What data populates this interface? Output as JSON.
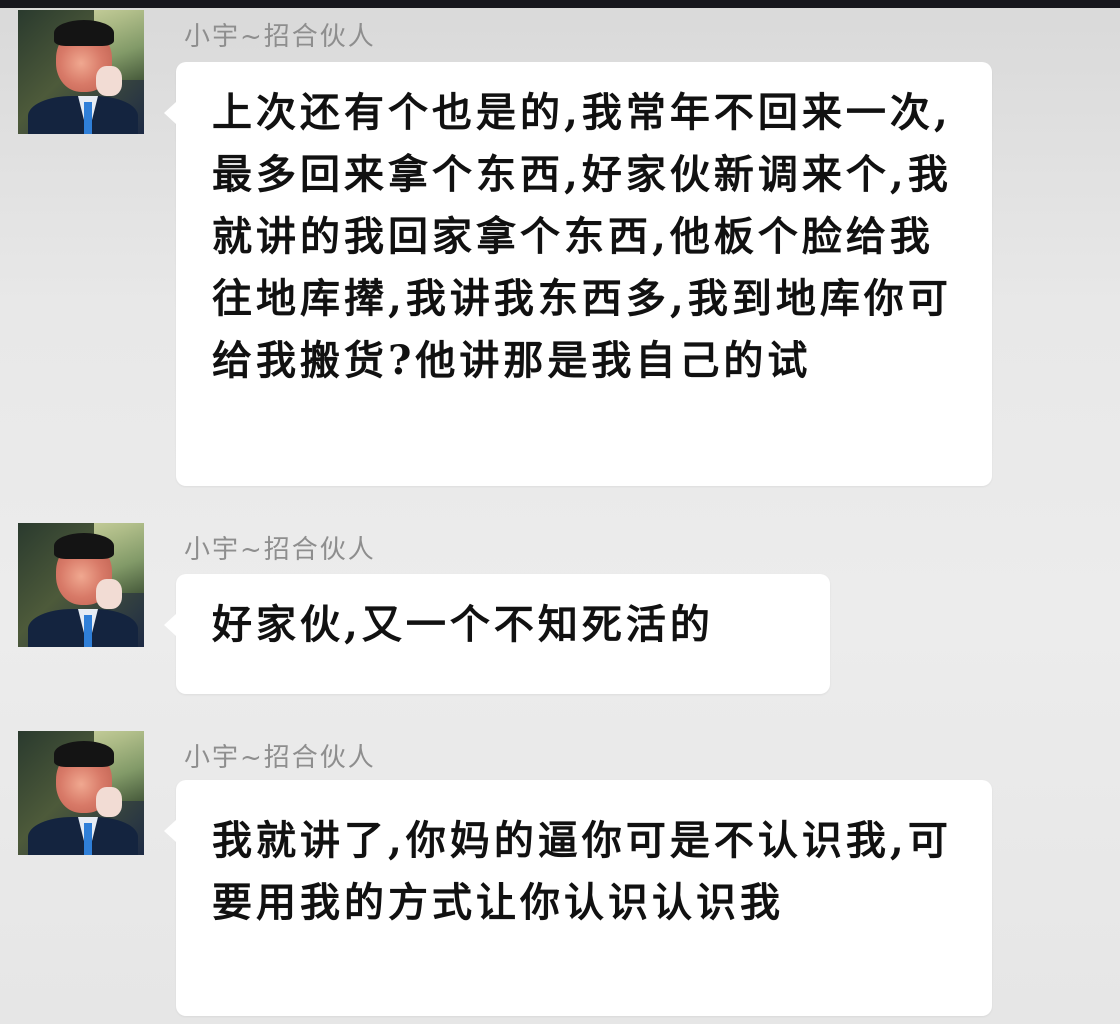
{
  "chat": {
    "messages": [
      {
        "sender": "小宇~招合伙人",
        "avatar": "avatar-man-in-suit",
        "text": "上次还有个也是的,我常年不回来一次,最多回来拿个东西,好家伙新调来个,我就讲的我回家拿个东西,他板个脸给我往地库撵,我讲我东西多,我到地库你可给我搬货?他讲那是我自己的试"
      },
      {
        "sender": "小宇~招合伙人",
        "avatar": "avatar-man-in-suit",
        "text": "好家伙,又一个不知死活的"
      },
      {
        "sender": "小宇~招合伙人",
        "avatar": "avatar-man-in-suit",
        "text": "我就讲了,你妈的逼你可是不认识我,可要用我的方式让你认识认识我"
      }
    ]
  },
  "colors": {
    "background": "#e8e8e8",
    "bubble": "#ffffff",
    "sender_text": "#8e8e8e",
    "message_text": "#111111"
  }
}
